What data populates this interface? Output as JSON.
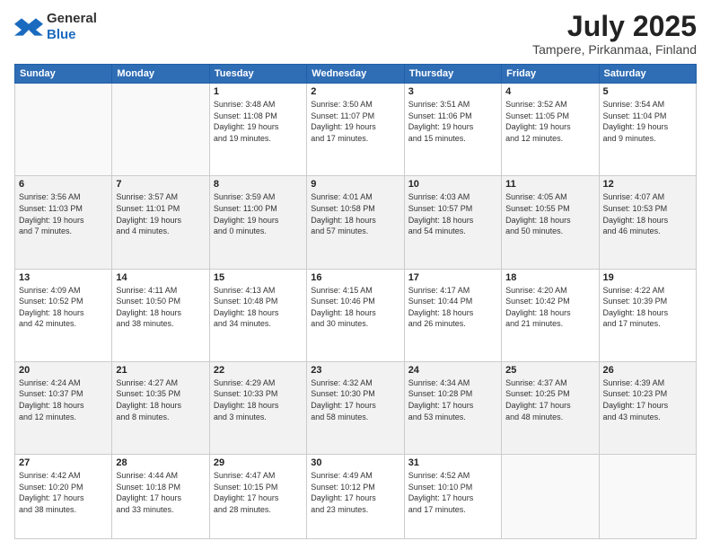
{
  "logo": {
    "general": "General",
    "blue": "Blue"
  },
  "header": {
    "month": "July 2025",
    "location": "Tampere, Pirkanmaa, Finland"
  },
  "weekdays": [
    "Sunday",
    "Monday",
    "Tuesday",
    "Wednesday",
    "Thursday",
    "Friday",
    "Saturday"
  ],
  "weeks": [
    [
      {
        "day": "",
        "info": ""
      },
      {
        "day": "",
        "info": ""
      },
      {
        "day": "1",
        "info": "Sunrise: 3:48 AM\nSunset: 11:08 PM\nDaylight: 19 hours\nand 19 minutes."
      },
      {
        "day": "2",
        "info": "Sunrise: 3:50 AM\nSunset: 11:07 PM\nDaylight: 19 hours\nand 17 minutes."
      },
      {
        "day": "3",
        "info": "Sunrise: 3:51 AM\nSunset: 11:06 PM\nDaylight: 19 hours\nand 15 minutes."
      },
      {
        "day": "4",
        "info": "Sunrise: 3:52 AM\nSunset: 11:05 PM\nDaylight: 19 hours\nand 12 minutes."
      },
      {
        "day": "5",
        "info": "Sunrise: 3:54 AM\nSunset: 11:04 PM\nDaylight: 19 hours\nand 9 minutes."
      }
    ],
    [
      {
        "day": "6",
        "info": "Sunrise: 3:56 AM\nSunset: 11:03 PM\nDaylight: 19 hours\nand 7 minutes."
      },
      {
        "day": "7",
        "info": "Sunrise: 3:57 AM\nSunset: 11:01 PM\nDaylight: 19 hours\nand 4 minutes."
      },
      {
        "day": "8",
        "info": "Sunrise: 3:59 AM\nSunset: 11:00 PM\nDaylight: 19 hours\nand 0 minutes."
      },
      {
        "day": "9",
        "info": "Sunrise: 4:01 AM\nSunset: 10:58 PM\nDaylight: 18 hours\nand 57 minutes."
      },
      {
        "day": "10",
        "info": "Sunrise: 4:03 AM\nSunset: 10:57 PM\nDaylight: 18 hours\nand 54 minutes."
      },
      {
        "day": "11",
        "info": "Sunrise: 4:05 AM\nSunset: 10:55 PM\nDaylight: 18 hours\nand 50 minutes."
      },
      {
        "day": "12",
        "info": "Sunrise: 4:07 AM\nSunset: 10:53 PM\nDaylight: 18 hours\nand 46 minutes."
      }
    ],
    [
      {
        "day": "13",
        "info": "Sunrise: 4:09 AM\nSunset: 10:52 PM\nDaylight: 18 hours\nand 42 minutes."
      },
      {
        "day": "14",
        "info": "Sunrise: 4:11 AM\nSunset: 10:50 PM\nDaylight: 18 hours\nand 38 minutes."
      },
      {
        "day": "15",
        "info": "Sunrise: 4:13 AM\nSunset: 10:48 PM\nDaylight: 18 hours\nand 34 minutes."
      },
      {
        "day": "16",
        "info": "Sunrise: 4:15 AM\nSunset: 10:46 PM\nDaylight: 18 hours\nand 30 minutes."
      },
      {
        "day": "17",
        "info": "Sunrise: 4:17 AM\nSunset: 10:44 PM\nDaylight: 18 hours\nand 26 minutes."
      },
      {
        "day": "18",
        "info": "Sunrise: 4:20 AM\nSunset: 10:42 PM\nDaylight: 18 hours\nand 21 minutes."
      },
      {
        "day": "19",
        "info": "Sunrise: 4:22 AM\nSunset: 10:39 PM\nDaylight: 18 hours\nand 17 minutes."
      }
    ],
    [
      {
        "day": "20",
        "info": "Sunrise: 4:24 AM\nSunset: 10:37 PM\nDaylight: 18 hours\nand 12 minutes."
      },
      {
        "day": "21",
        "info": "Sunrise: 4:27 AM\nSunset: 10:35 PM\nDaylight: 18 hours\nand 8 minutes."
      },
      {
        "day": "22",
        "info": "Sunrise: 4:29 AM\nSunset: 10:33 PM\nDaylight: 18 hours\nand 3 minutes."
      },
      {
        "day": "23",
        "info": "Sunrise: 4:32 AM\nSunset: 10:30 PM\nDaylight: 17 hours\nand 58 minutes."
      },
      {
        "day": "24",
        "info": "Sunrise: 4:34 AM\nSunset: 10:28 PM\nDaylight: 17 hours\nand 53 minutes."
      },
      {
        "day": "25",
        "info": "Sunrise: 4:37 AM\nSunset: 10:25 PM\nDaylight: 17 hours\nand 48 minutes."
      },
      {
        "day": "26",
        "info": "Sunrise: 4:39 AM\nSunset: 10:23 PM\nDaylight: 17 hours\nand 43 minutes."
      }
    ],
    [
      {
        "day": "27",
        "info": "Sunrise: 4:42 AM\nSunset: 10:20 PM\nDaylight: 17 hours\nand 38 minutes."
      },
      {
        "day": "28",
        "info": "Sunrise: 4:44 AM\nSunset: 10:18 PM\nDaylight: 17 hours\nand 33 minutes."
      },
      {
        "day": "29",
        "info": "Sunrise: 4:47 AM\nSunset: 10:15 PM\nDaylight: 17 hours\nand 28 minutes."
      },
      {
        "day": "30",
        "info": "Sunrise: 4:49 AM\nSunset: 10:12 PM\nDaylight: 17 hours\nand 23 minutes."
      },
      {
        "day": "31",
        "info": "Sunrise: 4:52 AM\nSunset: 10:10 PM\nDaylight: 17 hours\nand 17 minutes."
      },
      {
        "day": "",
        "info": ""
      },
      {
        "day": "",
        "info": ""
      }
    ]
  ]
}
